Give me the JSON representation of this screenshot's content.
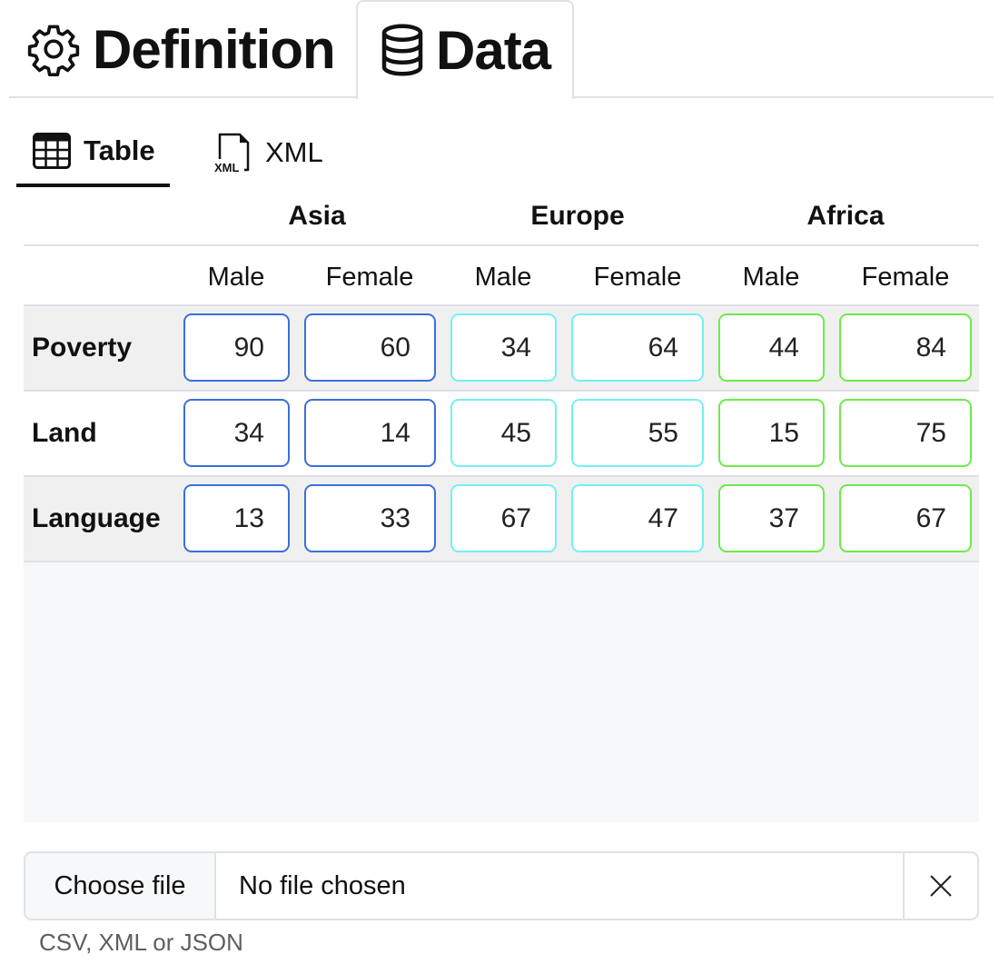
{
  "main_tabs": [
    {
      "label": "Definition",
      "icon": "gear-icon",
      "active": false
    },
    {
      "label": "Data",
      "icon": "database-icon",
      "active": true
    }
  ],
  "sub_tabs": [
    {
      "label": "Table",
      "icon": "table-icon",
      "active": true
    },
    {
      "label": "XML",
      "icon": "xml-file-icon",
      "active": false
    }
  ],
  "table": {
    "regions": [
      {
        "name": "Asia",
        "color": "#3b6fdb"
      },
      {
        "name": "Europe",
        "color": "#72f1f5"
      },
      {
        "name": "Africa",
        "color": "#6eea4b"
      }
    ],
    "genders": [
      "Male",
      "Female",
      "Male",
      "Female",
      "Male",
      "Female"
    ],
    "rows": [
      {
        "label": "Poverty",
        "values": [
          "90",
          "60",
          "34",
          "64",
          "44",
          "84"
        ]
      },
      {
        "label": "Land",
        "values": [
          "34",
          "14",
          "45",
          "55",
          "15",
          "75"
        ]
      },
      {
        "label": "Language",
        "values": [
          "13",
          "33",
          "67",
          "47",
          "37",
          "67"
        ]
      }
    ]
  },
  "file_input": {
    "button_label": "Choose file",
    "status": "No file chosen",
    "clear_icon": "close-icon",
    "hint": "CSV, XML or JSON"
  }
}
